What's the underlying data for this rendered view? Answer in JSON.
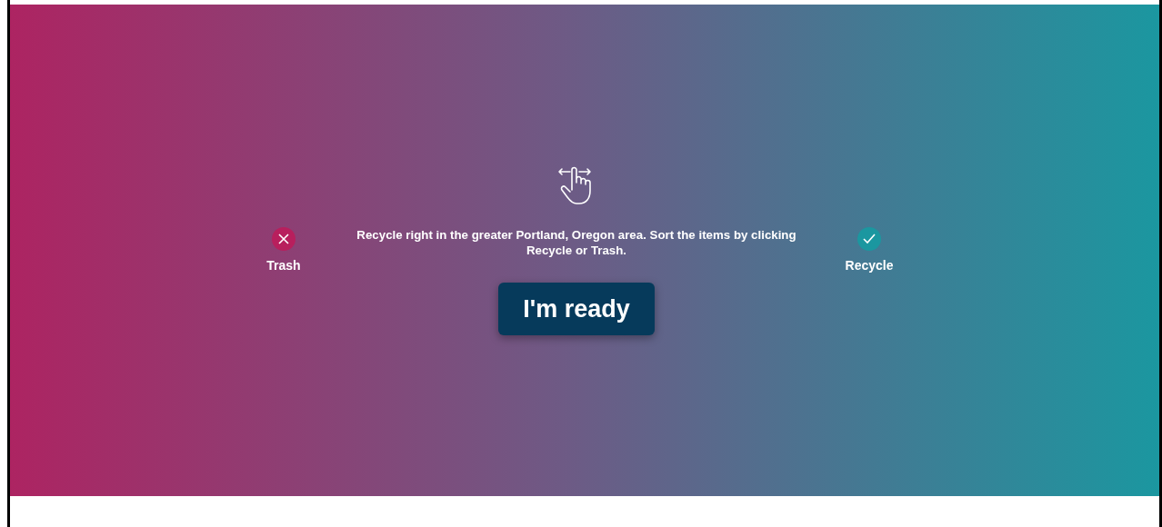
{
  "trash": {
    "label": "Trash"
  },
  "message": "Recycle right in the greater Portland, Oregon area. Sort the items by clicking Recycle or Trash.",
  "recycle": {
    "label": "Recycle"
  },
  "start_button": {
    "label": "I'm ready"
  }
}
